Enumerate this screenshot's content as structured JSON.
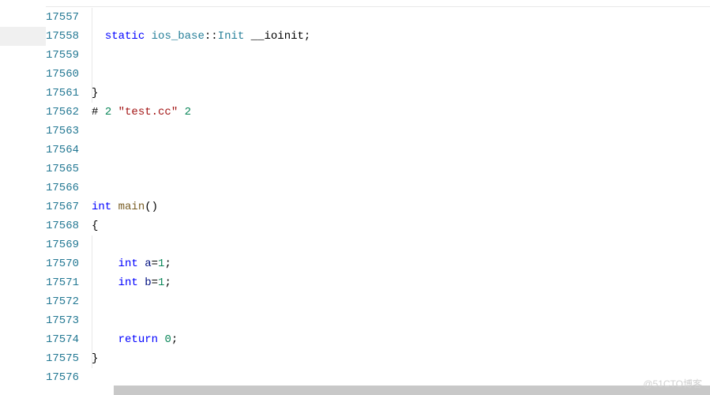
{
  "lines": [
    {
      "num": "17557",
      "tokens": []
    },
    {
      "num": "17558",
      "tokens": [
        {
          "t": "  ",
          "c": "plain"
        },
        {
          "t": "static",
          "c": "kw"
        },
        {
          "t": " ",
          "c": "plain"
        },
        {
          "t": "ios_base",
          "c": "type"
        },
        {
          "t": "::",
          "c": "op"
        },
        {
          "t": "Init",
          "c": "type"
        },
        {
          "t": " __ioinit;",
          "c": "plain"
        }
      ]
    },
    {
      "num": "17559",
      "tokens": []
    },
    {
      "num": "17560",
      "tokens": []
    },
    {
      "num": "17561",
      "tokens": [
        {
          "t": "}",
          "c": "plain"
        }
      ]
    },
    {
      "num": "17562",
      "tokens": [
        {
          "t": "# ",
          "c": "plain"
        },
        {
          "t": "2",
          "c": "num"
        },
        {
          "t": " ",
          "c": "plain"
        },
        {
          "t": "\"test.cc\"",
          "c": "str"
        },
        {
          "t": " ",
          "c": "plain"
        },
        {
          "t": "2",
          "c": "num"
        }
      ]
    },
    {
      "num": "17563",
      "tokens": []
    },
    {
      "num": "17564",
      "tokens": []
    },
    {
      "num": "17565",
      "tokens": []
    },
    {
      "num": "17566",
      "tokens": []
    },
    {
      "num": "17567",
      "tokens": [
        {
          "t": "int",
          "c": "kw"
        },
        {
          "t": " ",
          "c": "plain"
        },
        {
          "t": "main",
          "c": "fn"
        },
        {
          "t": "()",
          "c": "plain"
        }
      ]
    },
    {
      "num": "17568",
      "tokens": [
        {
          "t": "{",
          "c": "plain"
        }
      ]
    },
    {
      "num": "17569",
      "tokens": []
    },
    {
      "num": "17570",
      "tokens": [
        {
          "t": "    ",
          "c": "plain"
        },
        {
          "t": "int",
          "c": "kw"
        },
        {
          "t": " ",
          "c": "plain"
        },
        {
          "t": "a",
          "c": "ident"
        },
        {
          "t": "=",
          "c": "op"
        },
        {
          "t": "1",
          "c": "num"
        },
        {
          "t": ";",
          "c": "plain"
        }
      ]
    },
    {
      "num": "17571",
      "tokens": [
        {
          "t": "    ",
          "c": "plain"
        },
        {
          "t": "int",
          "c": "kw"
        },
        {
          "t": " ",
          "c": "plain"
        },
        {
          "t": "b",
          "c": "ident"
        },
        {
          "t": "=",
          "c": "op"
        },
        {
          "t": "1",
          "c": "num"
        },
        {
          "t": ";",
          "c": "plain"
        }
      ]
    },
    {
      "num": "17572",
      "tokens": []
    },
    {
      "num": "17573",
      "tokens": []
    },
    {
      "num": "17574",
      "tokens": [
        {
          "t": "    ",
          "c": "plain"
        },
        {
          "t": "return",
          "c": "kw"
        },
        {
          "t": " ",
          "c": "plain"
        },
        {
          "t": "0",
          "c": "num"
        },
        {
          "t": ";",
          "c": "plain"
        }
      ]
    },
    {
      "num": "17575",
      "tokens": [
        {
          "t": "}",
          "c": "plain"
        }
      ]
    },
    {
      "num": "17576",
      "tokens": []
    }
  ],
  "highlight_line_index": 1,
  "watermark": "@51CTO博客",
  "indent_guides": {
    "block1": {
      "start": 0,
      "end": 4,
      "col": 0
    },
    "block2": {
      "start": 12,
      "end": 18,
      "col": 0
    }
  }
}
